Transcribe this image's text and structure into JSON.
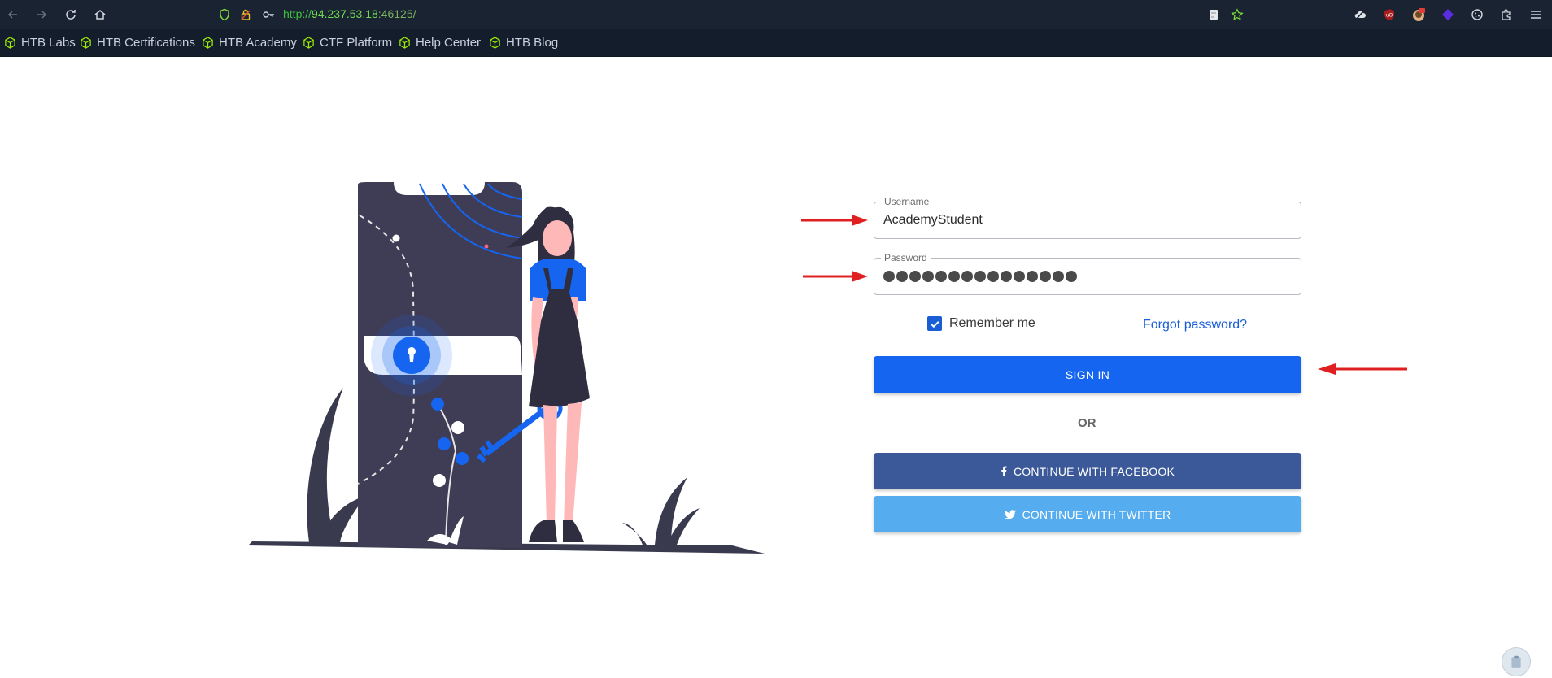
{
  "browser": {
    "url_prefix": "http://",
    "url_host": "94.237.53.18",
    "url_port": ":46125/",
    "bookmarks": [
      {
        "label": "HTB Labs"
      },
      {
        "label": "HTB Certifications"
      },
      {
        "label": "HTB Academy"
      },
      {
        "label": "CTF Platform"
      },
      {
        "label": "Help Center"
      },
      {
        "label": "HTB Blog"
      }
    ]
  },
  "login": {
    "username_label": "Username",
    "username_value": "AcademyStudent",
    "password_label": "Password",
    "password_length": 15,
    "remember_label": "Remember me",
    "remember_checked": true,
    "forgot_label": "Forgot password?",
    "signin_label": "SIGN IN",
    "or_label": "OR",
    "facebook_label": "CONTINUE WITH FACEBOOK",
    "twitter_label": "CONTINUE WITH TWITTER"
  },
  "colors": {
    "primary": "#1565f0",
    "facebook": "#3b5998",
    "twitter": "#55acee",
    "annotation_arrow": "#e02020",
    "chrome_bg": "#1a2332"
  }
}
